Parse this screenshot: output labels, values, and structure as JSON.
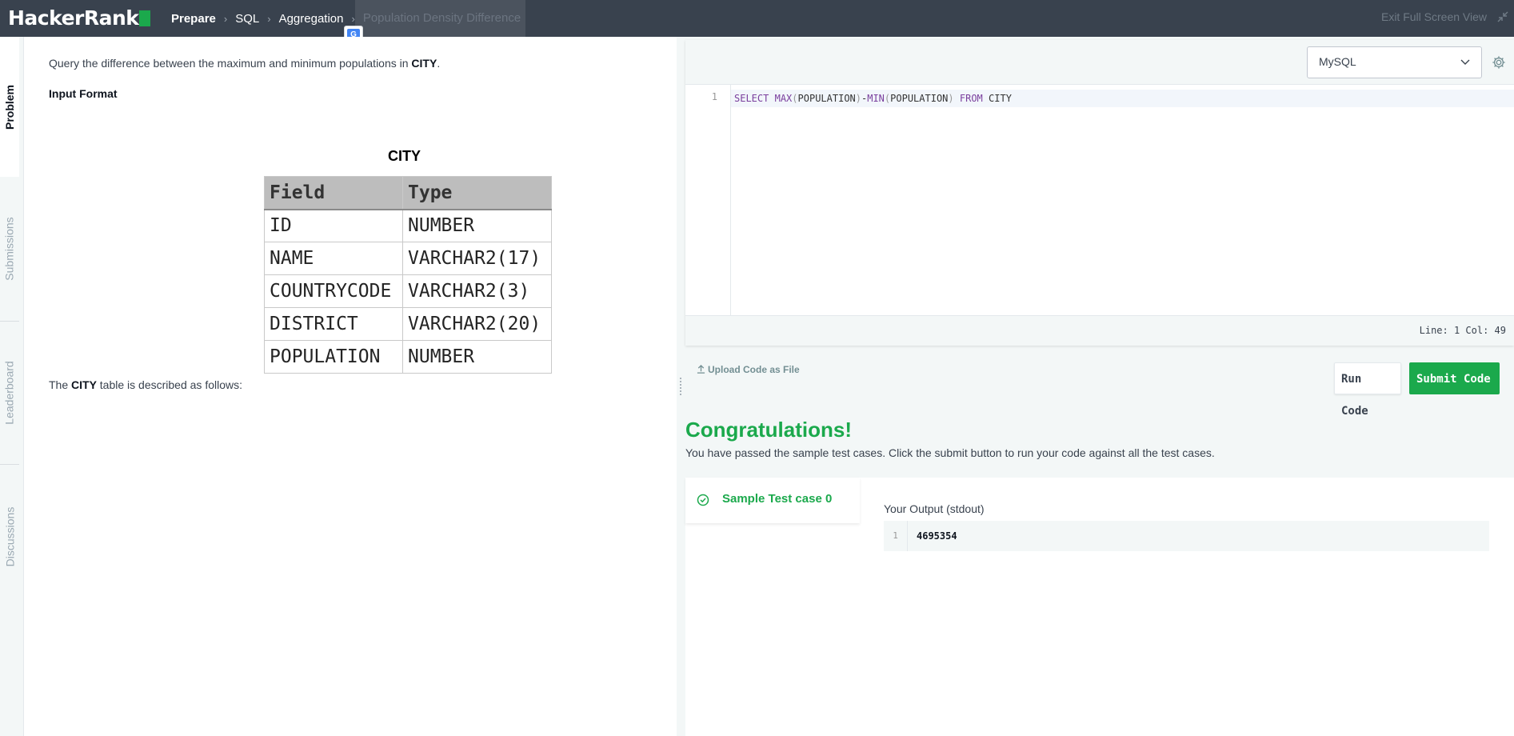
{
  "app": {
    "logo_text": "HackerRank",
    "brand_color": "#1ba94c"
  },
  "breadcrumbs": [
    {
      "label": "Prepare"
    },
    {
      "label": "SQL"
    },
    {
      "label": "Aggregation"
    },
    {
      "label": "Population Density Difference"
    }
  ],
  "topbar": {
    "exit_fullscreen": "Exit Full Screen View"
  },
  "sidebar": {
    "tabs": [
      {
        "label": "Problem",
        "active": true
      },
      {
        "label": "Submissions",
        "active": false
      },
      {
        "label": "Leaderboard",
        "active": false
      },
      {
        "label": "Discussions",
        "active": false
      }
    ]
  },
  "problem": {
    "statement_pre": "Query the difference between the maximum and minimum populations in ",
    "statement_bold": "CITY",
    "statement_post": ".",
    "input_format_heading": "Input Format",
    "table_title": "CITY",
    "table_headers": [
      "Field",
      "Type"
    ],
    "table_rows": [
      [
        "ID",
        "NUMBER"
      ],
      [
        "NAME",
        "VARCHAR2(17)"
      ],
      [
        "COUNTRYCODE",
        "VARCHAR2(3)"
      ],
      [
        "DISTRICT",
        "VARCHAR2(20)"
      ],
      [
        "POPULATION",
        "NUMBER"
      ]
    ],
    "described_pre": "The ",
    "described_bold": "CITY",
    "described_post": " table is described as follows:"
  },
  "editor": {
    "language": "MySQL",
    "line_number": "1",
    "code_tokens": {
      "select": "SELECT",
      "max": "MAX",
      "open1": "(",
      "arg1": "POPULATION",
      "close1": ")",
      "minus": "-",
      "min": "MIN",
      "open2": "(",
      "arg2": "POPULATION",
      "close2": ")",
      "from": "FROM",
      "table": "CITY"
    },
    "cursor_status": "Line: 1 Col: 49"
  },
  "actions": {
    "upload": "Upload Code as File",
    "run": "Run Code",
    "submit": "Submit Code"
  },
  "result": {
    "title": "Congratulations!",
    "message": "You have passed the sample test cases. Click the submit button to run your code against all the test cases.",
    "testcase_label": "Sample Test case 0",
    "output_label": "Your Output (stdout)",
    "output_line_number": "1",
    "output_value": "4695354"
  }
}
